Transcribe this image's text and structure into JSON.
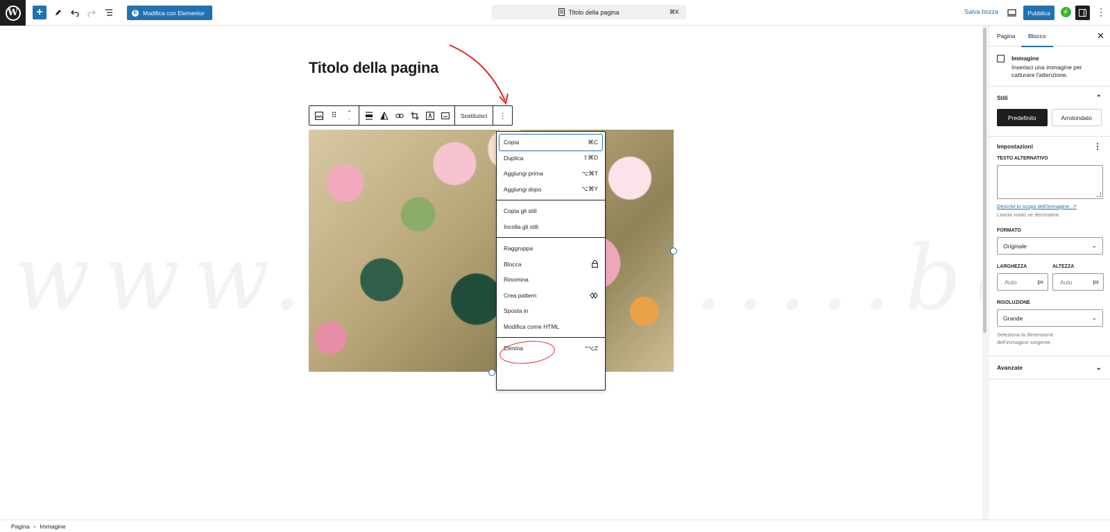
{
  "topbar": {
    "elementor_label": "Modifica con Elementor",
    "doc_title": "Titolo della pagina",
    "doc_shortcut": "⌘K",
    "save_draft": "Salva bozza",
    "publish": "Pubblica"
  },
  "canvas": {
    "page_title": "Titolo della pagina",
    "toolbar_replace": "Sostituisci",
    "watermark": "www.l.............bon.com"
  },
  "menu": {
    "section1": [
      {
        "label": "Copia",
        "shortcut": "⌘C"
      },
      {
        "label": "Duplica",
        "shortcut": "⇧⌘D"
      },
      {
        "label": "Aggiungi prima",
        "shortcut": "⌥⌘T"
      },
      {
        "label": "Aggiungi dopo",
        "shortcut": "⌥⌘Y"
      }
    ],
    "section2": [
      {
        "label": "Copia gli stili"
      },
      {
        "label": "Incolla gli stili"
      }
    ],
    "section3": [
      {
        "label": "Raggruppa"
      },
      {
        "label": "Blocca",
        "icon": "lock-icon"
      },
      {
        "label": "Rinomina"
      },
      {
        "label": "Crea pattern",
        "icon": "pattern-icon"
      },
      {
        "label": "Sposta in"
      },
      {
        "label": "Modifica come HTML"
      }
    ],
    "section4": [
      {
        "label": "Elimina",
        "shortcut": "^⌥Z"
      }
    ]
  },
  "statusbar": {
    "crumb1": "Pagina",
    "crumb2": "Immagine"
  },
  "sidebar": {
    "tab_page": "Pagina",
    "tab_block": "Blocco",
    "block_name": "Immagine",
    "block_desc": "Inserisci una immagine per catturare l'attenzione.",
    "styles_title": "Stili",
    "style_default": "Predefinito",
    "style_rounded": "Arrotondato",
    "settings_title": "Impostazioni",
    "alt_label": "TESTO ALTERNATIVO",
    "alt_link": "Descrivi lo scopo dell'immagine. ↗",
    "alt_help": "Lascia vuoto se decorativa.",
    "format_label": "FORMATO",
    "format_value": "Originale",
    "width_label": "LARGHEZZA",
    "height_label": "ALTEZZA",
    "dim_placeholder": "Auto",
    "dim_unit": "px",
    "resolution_label": "RISOLUZIONE",
    "resolution_value": "Grande",
    "resolution_help": "Seleziona la dimensione dell'immagine sorgente.",
    "advanced_title": "Avanzate"
  },
  "colors": {
    "accent": "#2271b1",
    "annotation": "#e02424",
    "dark": "#1e1e1e"
  }
}
